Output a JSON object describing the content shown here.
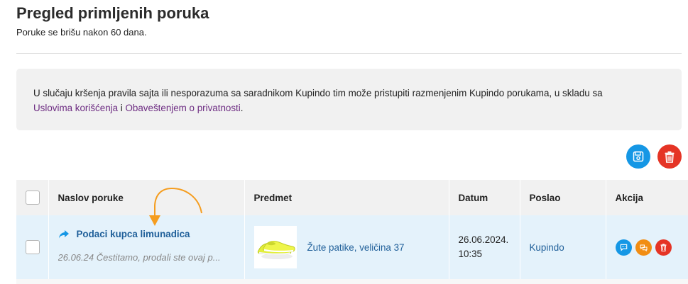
{
  "header": {
    "title": "Pregled primljenih poruka",
    "subtitle": "Poruke se brišu nakon 60 dana."
  },
  "notice": {
    "text_before": "U slučaju kršenja pravila sajta ili nesporazuma sa saradnikom Kupindo tim može pristupiti razmenjenim Kupindo porukama, u skladu sa",
    "link_terms": "Uslovima korišćenja",
    "text_and": " i ",
    "link_privacy": "Obaveštenjem o privatnosti",
    "text_end": "."
  },
  "toolbar": {
    "save_icon": "save-icon",
    "delete_icon": "trash-icon"
  },
  "table": {
    "columns": {
      "subject": "Naslov poruke",
      "item": "Predmet",
      "date": "Datum",
      "sender": "Poslao",
      "action": "Akcija"
    },
    "rows": [
      {
        "subject": "Podaci kupca limunadica",
        "snippet": "26.06.24 Čestitamo, prodali ste ovaj p...",
        "item": "Žute patike, veličina 37",
        "date_line1": "26.06.2024.",
        "date_line2": "10:35",
        "sender": "Kupindo"
      }
    ]
  },
  "colors": {
    "accent_blue": "#1597e5",
    "accent_red": "#e53425",
    "accent_orange": "#f18d13",
    "link_blue": "#1f5f99",
    "link_purple": "#6d2c82",
    "row_highlight": "#e4f2fb"
  }
}
